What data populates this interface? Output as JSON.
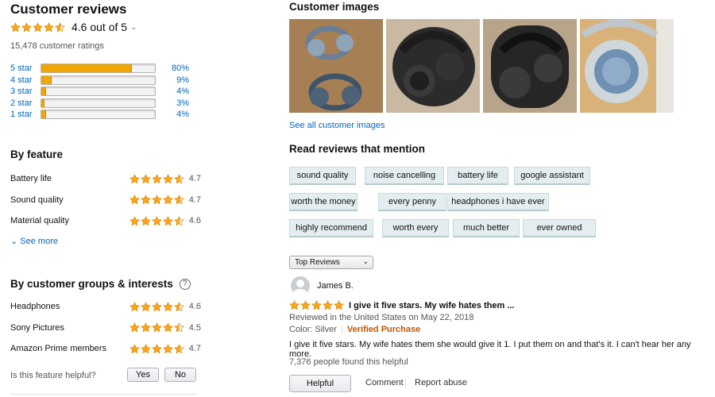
{
  "ratings": {
    "heading": "Customer reviews",
    "average_text": "4.6 out of 5",
    "average_stars": 4.6,
    "total_text": "15,478 customer ratings",
    "histogram": [
      {
        "label": "5 star",
        "percent_text": "80%",
        "fill_fraction": 0.8
      },
      {
        "label": "4 star",
        "percent_text": "9%",
        "fill_fraction": 0.09
      },
      {
        "label": "3 star",
        "percent_text": "4%",
        "fill_fraction": 0.04
      },
      {
        "label": "2 star",
        "percent_text": "3%",
        "fill_fraction": 0.03
      },
      {
        "label": "1 star",
        "percent_text": "4%",
        "fill_fraction": 0.04
      }
    ]
  },
  "by_feature": {
    "heading": "By feature",
    "items": [
      {
        "name": "Battery life",
        "rating": "4.7",
        "stars": 4.7
      },
      {
        "name": "Sound quality",
        "rating": "4.7",
        "stars": 4.7
      },
      {
        "name": "Material quality",
        "rating": "4.6",
        "stars": 4.6
      }
    ],
    "see_more": "See more"
  },
  "by_groups": {
    "heading": "By customer groups & interests",
    "help_icon": "?",
    "items": [
      {
        "name": "Headphones",
        "rating": "4.6",
        "stars": 4.6
      },
      {
        "name": "Sony Pictures",
        "rating": "4.5",
        "stars": 4.5
      },
      {
        "name": "Amazon Prime members",
        "rating": "4.7",
        "stars": 4.7
      }
    ],
    "helpful_question": "Is this feature helpful?",
    "yes_label": "Yes",
    "no_label": "No"
  },
  "customer_images": {
    "heading": "Customer images",
    "see_all": "See all customer images",
    "images": [
      "headphones-photo-1",
      "headphones-photo-2",
      "headphones-photo-3",
      "headphones-photo-4"
    ]
  },
  "mentions": {
    "heading": "Read reviews that mention",
    "chips": [
      [
        "sound quality",
        "noise cancelling",
        "battery life",
        "google assistant"
      ],
      [
        "worth the money",
        "every penny",
        "headphones i have ever"
      ],
      [
        "highly recommend",
        "worth every",
        "much better",
        "ever owned"
      ]
    ]
  },
  "sort": {
    "selected": "Top Reviews"
  },
  "review": {
    "author": "James B.",
    "stars": 5,
    "title": "I give it five stars. My wife hates them ...",
    "meta": "Reviewed in the United States on May 22, 2018",
    "color": "Color: Silver",
    "verified": "Verified Purchase",
    "body": "I give it five stars. My wife hates them she would give it 1. I put them on and that's it. I can't hear her any more.",
    "helpful_count": "7,376 people found this helpful",
    "helpful_button": "Helpful",
    "comment": "Comment",
    "report": "Report abuse"
  },
  "colors": {
    "link": "#0066c0",
    "star": "#ffa41c",
    "bar_fill": "#f0a500",
    "verified": "#c45500",
    "chip_bg": "#e4eef0"
  }
}
